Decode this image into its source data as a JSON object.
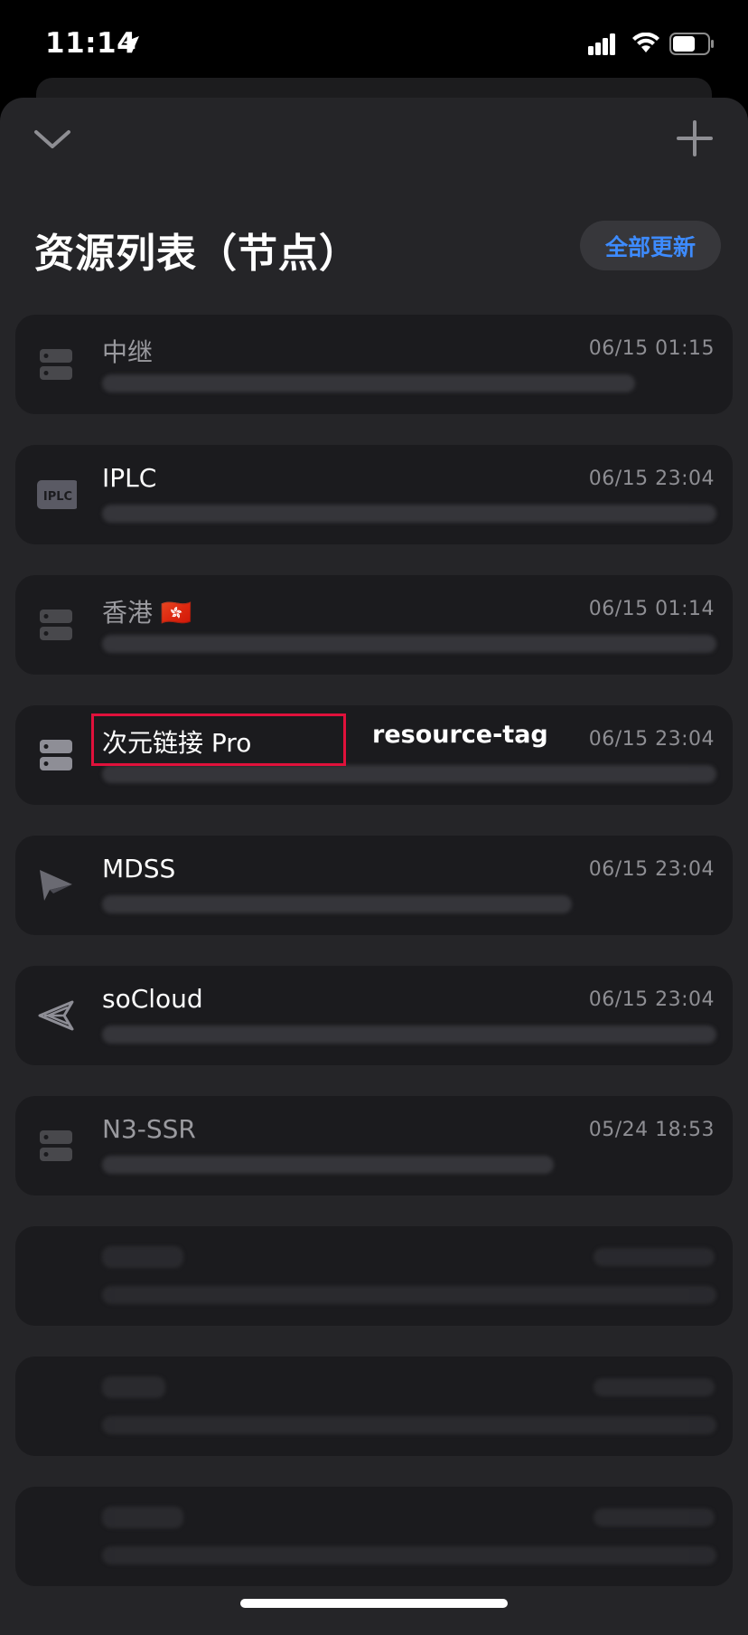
{
  "status_bar": {
    "time": "11:14"
  },
  "header": {
    "title": "资源列表（节点）",
    "update_all_label": "全部更新",
    "collapse_icon": "chevron-down-icon",
    "add_icon": "plus-icon"
  },
  "resources": [
    {
      "name": "中继",
      "date": "06/15 01:15",
      "icon": "server-icon",
      "active": false
    },
    {
      "name": "IPLC",
      "date": "06/15 23:04",
      "icon": "iplc-icon",
      "active": true
    },
    {
      "name": "香港 🇭🇰",
      "date": "06/15 01:14",
      "icon": "server-icon",
      "active": false
    },
    {
      "name": "次元链接 Pro",
      "date": "06/15 23:04",
      "icon": "server-icon",
      "active": true
    },
    {
      "name": "MDSS",
      "date": "06/15 23:04",
      "icon": "paper-plane-icon",
      "active": true
    },
    {
      "name": "soCloud",
      "date": "06/15 23:04",
      "icon": "socloud-icon",
      "active": true
    },
    {
      "name": "N3-SSR",
      "date": "05/24 18:53",
      "icon": "server-icon",
      "active": false
    }
  ],
  "annotation": {
    "label": "resource-tag"
  },
  "colors": {
    "accent": "#3d8bff",
    "highlight": "#e0113b",
    "sheet_bg": "#252528",
    "card_bg": "#1b1b1e"
  }
}
